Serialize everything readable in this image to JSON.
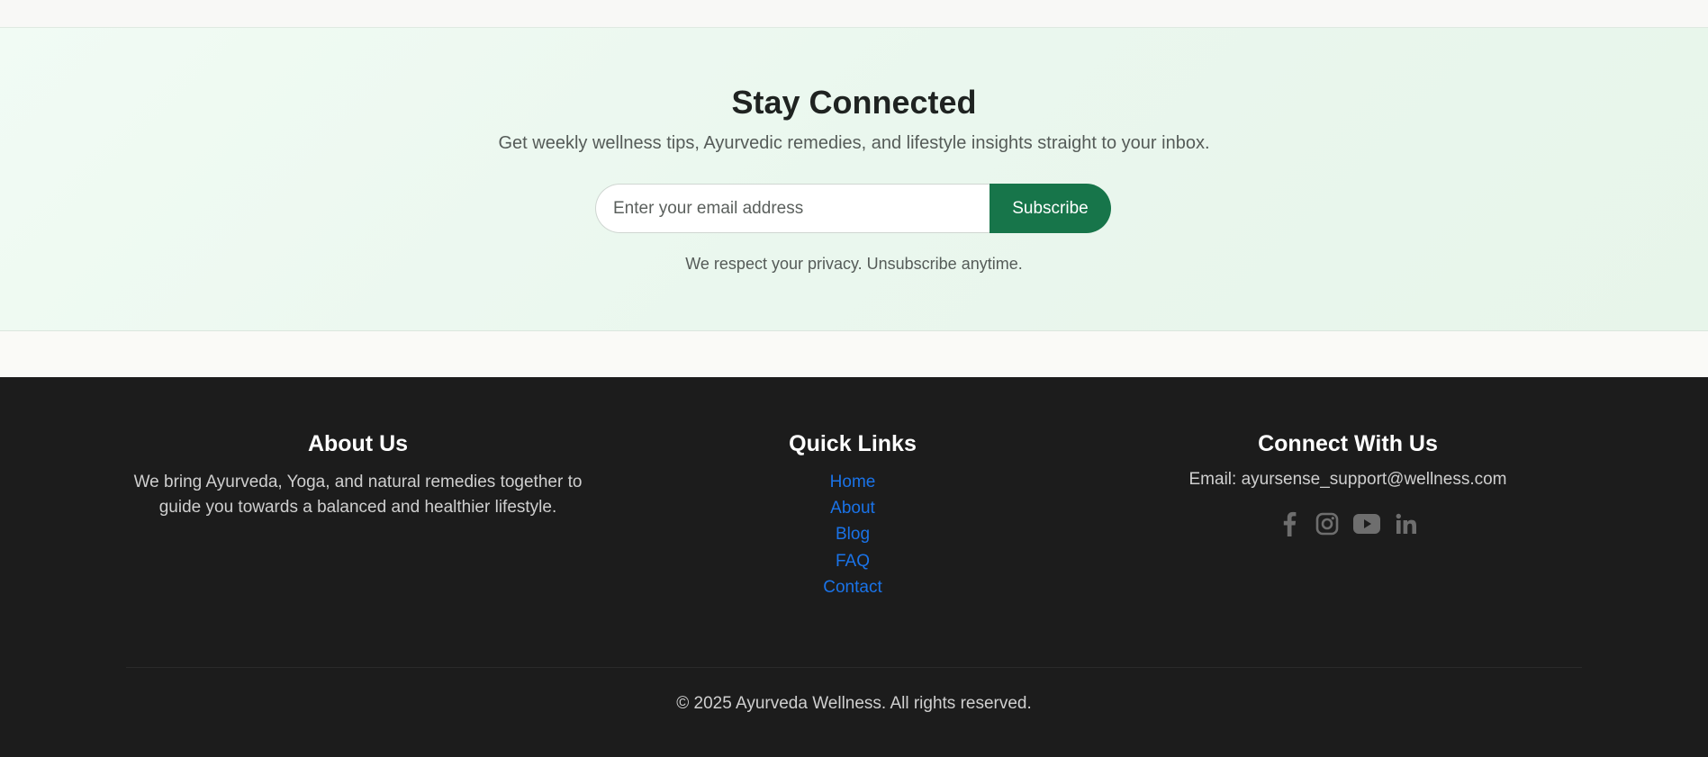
{
  "newsletter": {
    "title": "Stay Connected",
    "subtitle": "Get weekly wellness tips, Ayurvedic remedies, and lifestyle insights straight to your inbox.",
    "email_placeholder": "Enter your email address",
    "email_value": "",
    "subscribe_label": "Subscribe",
    "privacy_note": "We respect your privacy. Unsubscribe anytime."
  },
  "footer": {
    "about": {
      "heading": "About Us",
      "text": "We bring Ayurveda, Yoga, and natural remedies together to guide you towards a balanced and healthier lifestyle."
    },
    "quick_links": {
      "heading": "Quick Links",
      "items": [
        "Home",
        "About",
        "Blog",
        "FAQ",
        "Contact"
      ]
    },
    "connect": {
      "heading": "Connect With Us",
      "email_text": "Email: ayursense_support@wellness.com",
      "socials": [
        "facebook-icon",
        "instagram-icon",
        "youtube-icon",
        "linkedin-icon"
      ]
    },
    "copyright": "© 2025 Ayurveda Wellness. All rights reserved."
  },
  "colors": {
    "accent": "#17754a",
    "link": "#1a73e8",
    "footer_bg": "#1c1c1c",
    "icon": "#6e6e6e"
  }
}
